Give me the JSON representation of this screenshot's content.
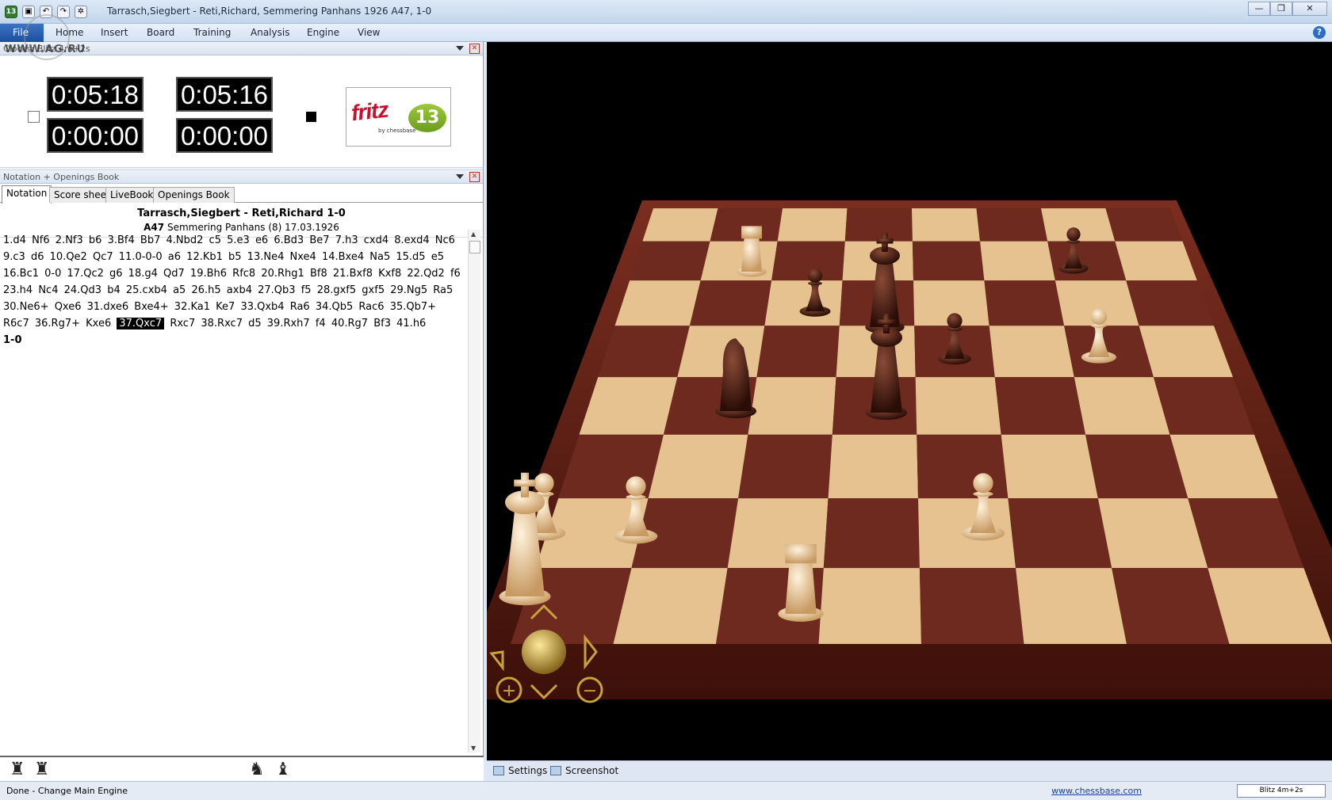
{
  "window": {
    "title": "Tarrasch,Siegbert - Reti,Richard, Semmering Panhans 1926  A47, 1-0",
    "app_badge": "13",
    "controls": [
      "—",
      "❐",
      "✕"
    ]
  },
  "menu": {
    "items": [
      "File",
      "Home",
      "Insert",
      "Board",
      "Training",
      "Analysis",
      "Engine",
      "View"
    ],
    "help": "?"
  },
  "watermark": "WWW.AG.RU",
  "clocks": {
    "title": "Clocks: Blitz 4m+2s",
    "white_time": "0:05:18",
    "black_time": "0:05:16",
    "white_move_time": "0:00:00",
    "black_move_time": "0:00:00",
    "logo_text": "fritz",
    "logo_version": "13",
    "logo_by": "by chessbase"
  },
  "notation_panel": {
    "title": "Notation + Openings Book",
    "tabs": [
      "Notation",
      "Score sheet",
      "LiveBook",
      "Openings Book"
    ],
    "active_tab": "Notation",
    "players": "Tarrasch,Siegbert - Reti,Richard  1-0",
    "eco": "A47",
    "event": "Semmering Panhans (8) 17.03.1926",
    "moves": [
      "1.d4",
      "Nf6",
      "2.Nf3",
      "b6",
      "3.Bf4",
      "Bb7",
      "4.Nbd2",
      "c5",
      "5.e3",
      "e6",
      "6.Bd3",
      "Be7",
      "7.h3",
      "cxd4",
      "8.exd4",
      "Nc6",
      "9.c3",
      "d6",
      "10.Qe2",
      "Qc7",
      "11.0-0-0",
      "a6",
      "12.Kb1",
      "b5",
      "13.Ne4",
      "Nxe4",
      "14.Bxe4",
      "Na5",
      "15.d5",
      "e5",
      "16.Bc1",
      "0-0",
      "17.Qc2",
      "g6",
      "18.g4",
      "Qd7",
      "19.Bh6",
      "Rfc8",
      "20.Rhg1",
      "Bf8",
      "21.Bxf8",
      "Kxf8",
      "22.Qd2",
      "f6",
      "23.h4",
      "Nc4",
      "24.Qd3",
      "b4",
      "25.cxb4",
      "a5",
      "26.h5",
      "axb4",
      "27.Qb3",
      "f5",
      "28.gxf5",
      "gxf5",
      "29.Ng5",
      "Ra5",
      "30.Ne6+",
      "Qxe6",
      "31.dxe6",
      "Bxe4+",
      "32.Ka1",
      "Ke7",
      "33.Qxb4",
      "Ra6",
      "34.Qb5",
      "Rac6",
      "35.Qb7+",
      "R6c7",
      "36.Rg7+",
      "Kxe6",
      "37.Qxc7",
      "Rxc7",
      "38.Rxc7",
      "d5",
      "39.Rxh7",
      "f4",
      "40.Rg7",
      "Bf3",
      "41.h6"
    ],
    "current_move_index": 72,
    "result": "1-0",
    "bottom_icons": [
      "rook-icon",
      "rook-icon",
      "knight-icon",
      "bishop-icon"
    ]
  },
  "board": {
    "nav_labels": {
      "zoom_in": "+",
      "zoom_out": "−"
    }
  },
  "bottom_tabs": [
    "Settings",
    "Screenshot"
  ],
  "status": {
    "text": "Done - Change Main Engine",
    "link": "www.chessbase.com",
    "time_control": "Blitz 4m+2s"
  },
  "colors": {
    "light_square": "#e5c28f",
    "dark_square": "#6e2a1e",
    "frame": "#5a1e14",
    "accent_blue": "#1d4f9c"
  }
}
